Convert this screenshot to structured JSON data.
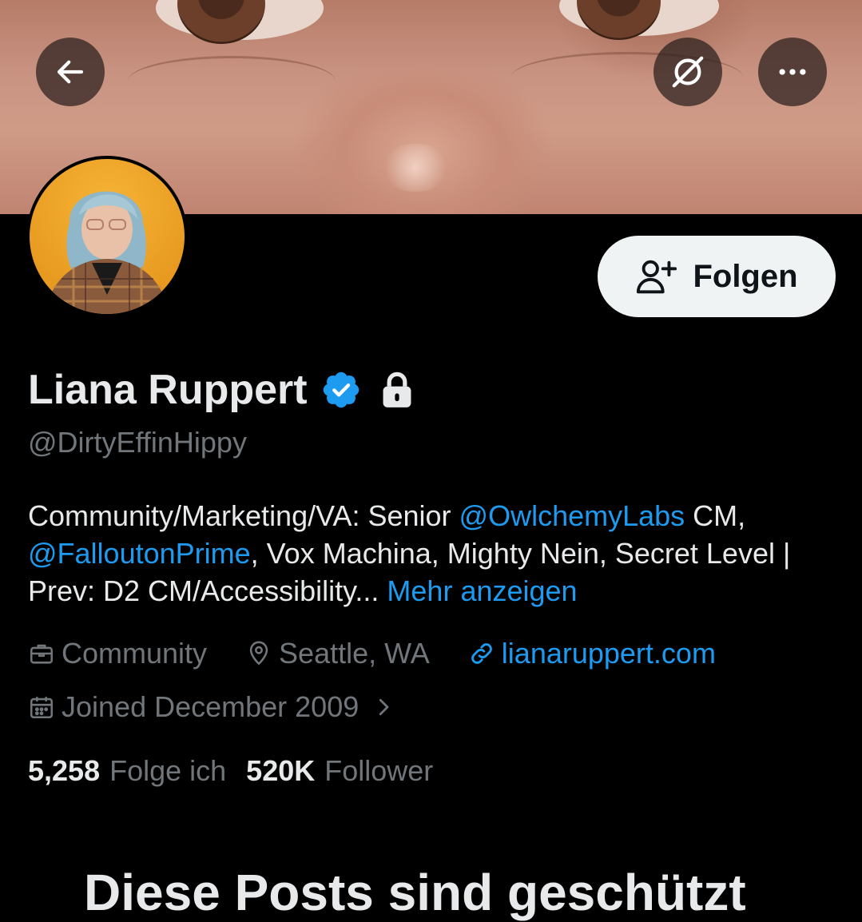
{
  "header": {
    "back_icon": "arrow-left-icon",
    "grok_icon": "grok-icon",
    "more_icon": "more-horizontal-icon"
  },
  "profile": {
    "name": "Liana Ruppert",
    "handle": "@DirtyEffinHippy",
    "verified": true,
    "protected": true,
    "follow_label": "Folgen",
    "bio": {
      "part1": "Community/Marketing/VA: Senior ",
      "mention1": "@OwlchemyLabs",
      "part2": " CM, ",
      "mention2": "@FalloutonPrime",
      "part3": ", Vox Machina, Mighty Nein, Secret Level | Prev: D2 CM/Accessibility... ",
      "more": "Mehr anzeigen"
    },
    "meta": {
      "category": "Community",
      "location": "Seattle, WA",
      "website": "lianaruppert.com",
      "joined": "Joined December 2009"
    },
    "stats": {
      "following_count": "5,258",
      "following_label": "Folge ich",
      "followers_count": "520K",
      "followers_label": "Follower"
    }
  },
  "bottom": {
    "title": "Diese Posts sind geschützt"
  },
  "colors": {
    "accent": "#1d9bf0",
    "muted": "#71767b",
    "text": "#e7e9ea",
    "background": "#000000"
  }
}
